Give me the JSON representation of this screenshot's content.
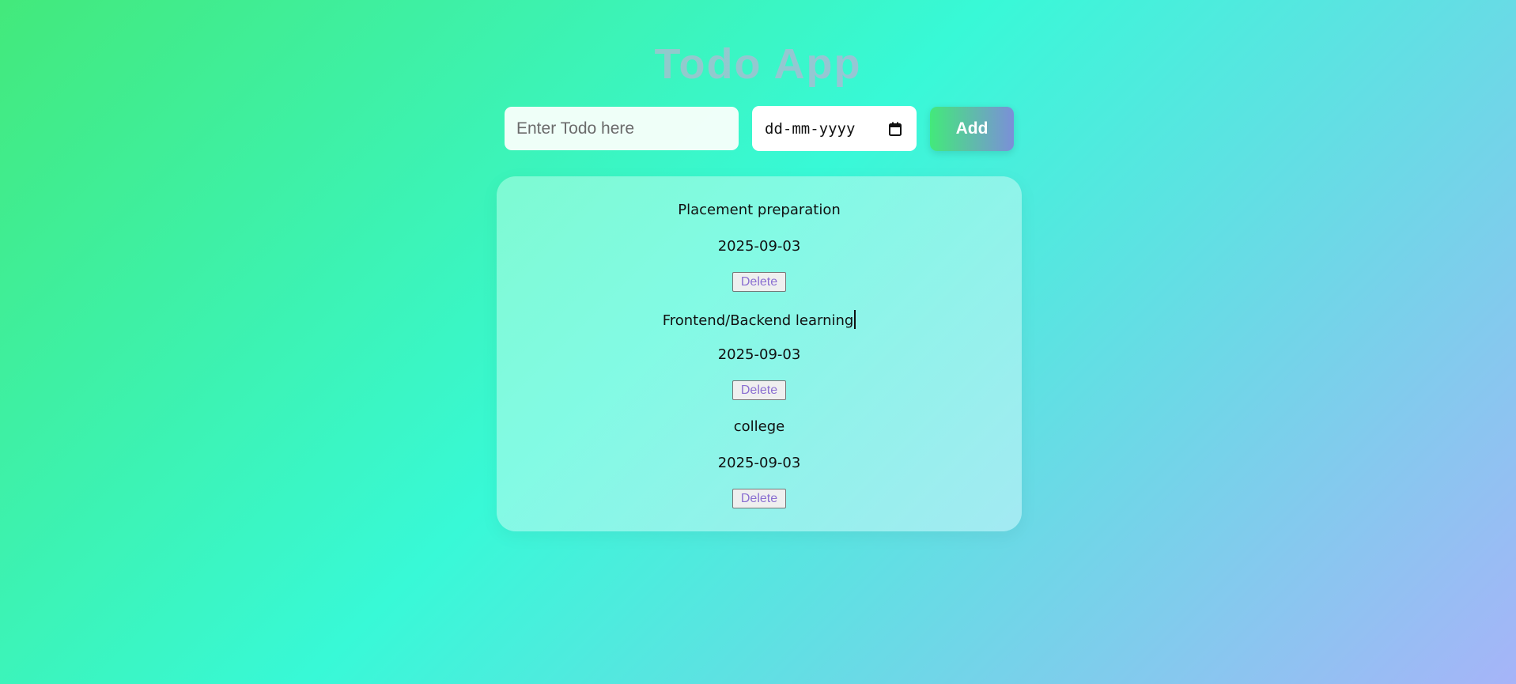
{
  "app": {
    "title": "Todo App"
  },
  "form": {
    "todo_placeholder": "Enter Todo here",
    "date_placeholder": "dd-mm-yyyy",
    "add_label": "Add"
  },
  "todos": [
    {
      "text": "Placement preparation",
      "date": "2025-09-03",
      "delete_label": "Delete"
    },
    {
      "text": "Frontend/Backend learning",
      "date": "2025-09-03",
      "delete_label": "Delete"
    },
    {
      "text": "college",
      "date": "2025-09-03",
      "delete_label": "Delete"
    }
  ],
  "colors": {
    "bg_start": "#43e97b",
    "bg_mid": "#38f9d7",
    "bg_end": "#a6b4f8",
    "delete_text": "#8a6fd1"
  },
  "icons": {
    "date_picker": "calendar-icon"
  }
}
